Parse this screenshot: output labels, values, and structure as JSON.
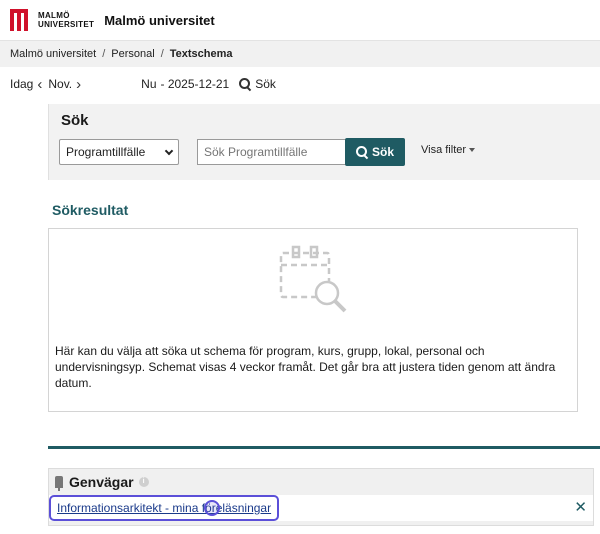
{
  "header": {
    "logo_line1": "MALMÖ",
    "logo_line2": "UNIVERSITET",
    "site_name": "Malmö universitet"
  },
  "breadcrumb": {
    "items": [
      "Malmö universitet",
      "Personal"
    ],
    "current": "Textschema"
  },
  "datebar": {
    "today": "Idag",
    "month": "Nov.",
    "now_label": "Nu",
    "now_date": "- 2025-12-21",
    "search": "Sök"
  },
  "search_panel": {
    "heading": "Sök",
    "type_selected": "Programtillfälle",
    "input_placeholder": "Sök Programtillfälle",
    "button_label": "Sök",
    "filter_label": "Visa filter"
  },
  "results": {
    "heading": "Sökresultat",
    "text": "Här kan du välja att söka ut schema för program, kurs, grupp, lokal, personal och undervisningsyp. Schemat visas 4 veckor framåt. Det går bra att justera tiden genom att ändra datum."
  },
  "shortcuts": {
    "heading": "Genvägar",
    "link": "Informationsarkitekt - mina föreläsningar",
    "close": "✕"
  },
  "colors": {
    "brand_red": "#d0112b",
    "accent_teal": "#1f5b63",
    "focus_ring": "#5b4fd8"
  }
}
